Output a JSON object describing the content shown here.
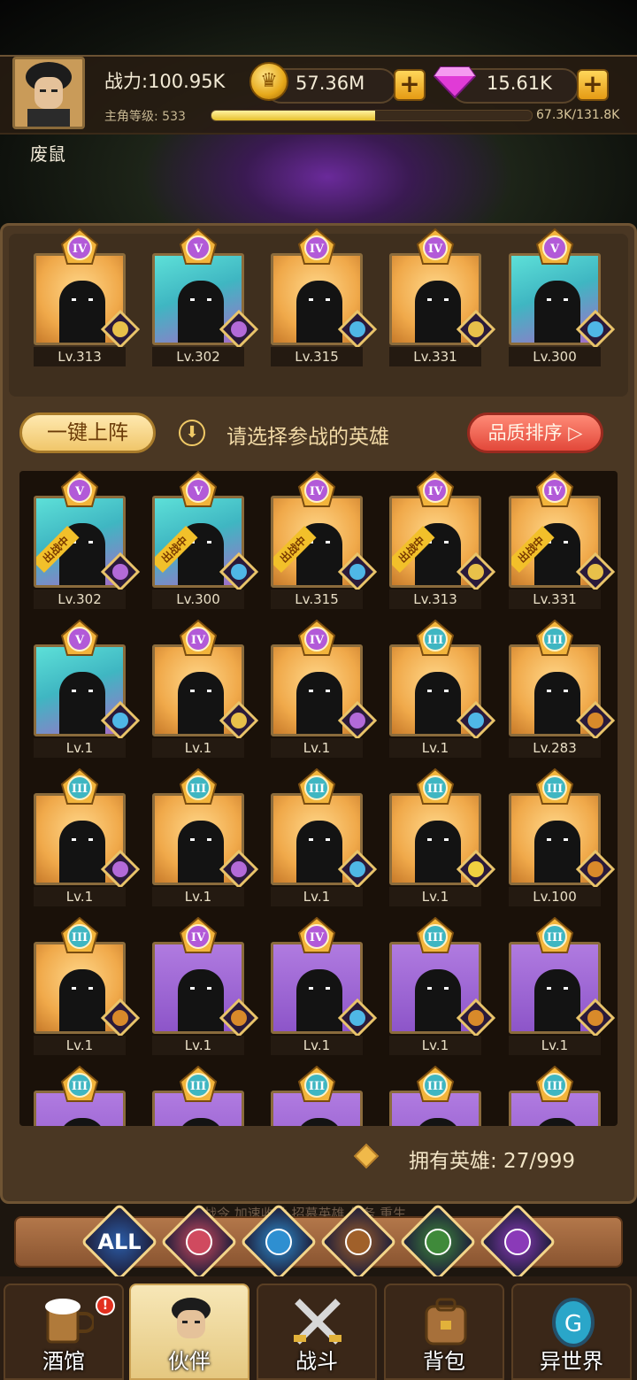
{
  "player": {
    "name": "废鼠",
    "power": "战力:100.95K",
    "level_label": "主角等级: 533",
    "exp_text": "67.3K/131.8K",
    "exp_progress": 0.51
  },
  "resources": {
    "gold": "57.36M",
    "gems": "15.61K"
  },
  "team": [
    {
      "rank": "IV",
      "quality": "gold",
      "faction": "knight",
      "level": "Lv.313"
    },
    {
      "rank": "V",
      "quality": "teal",
      "faction": "demon",
      "level": "Lv.302"
    },
    {
      "rank": "IV",
      "quality": "gold",
      "faction": "spirit",
      "level": "Lv.315"
    },
    {
      "rank": "IV",
      "quality": "gold",
      "faction": "knight",
      "level": "Lv.331"
    },
    {
      "rank": "V",
      "quality": "teal",
      "faction": "spirit",
      "level": "Lv.300"
    }
  ],
  "controls": {
    "auto_deploy": "一键上阵",
    "hint": "请选择参战的英雄",
    "sort": "品质排序 ▷",
    "deployed_ribbon": "出战中"
  },
  "roster": [
    {
      "rank": "V",
      "quality": "teal",
      "faction": "demon",
      "level": "Lv.302",
      "deployed": true
    },
    {
      "rank": "V",
      "quality": "teal",
      "faction": "spirit",
      "level": "Lv.300",
      "deployed": true
    },
    {
      "rank": "IV",
      "quality": "gold",
      "faction": "spirit",
      "level": "Lv.315",
      "deployed": true
    },
    {
      "rank": "IV",
      "quality": "gold",
      "faction": "knight",
      "level": "Lv.313",
      "deployed": true
    },
    {
      "rank": "IV",
      "quality": "gold",
      "faction": "knight",
      "level": "Lv.331",
      "deployed": true
    },
    {
      "rank": "V",
      "quality": "teal",
      "faction": "spirit",
      "level": "Lv.1"
    },
    {
      "rank": "IV",
      "quality": "gold",
      "faction": "knight",
      "level": "Lv.1"
    },
    {
      "rank": "IV",
      "quality": "gold",
      "faction": "demon",
      "level": "Lv.1"
    },
    {
      "rank": "III",
      "quality": "gold",
      "faction": "spirit",
      "level": "Lv.1"
    },
    {
      "rank": "III",
      "quality": "gold",
      "faction": "lion",
      "level": "Lv.283"
    },
    {
      "rank": "III",
      "quality": "gold",
      "faction": "demon",
      "level": "Lv.1"
    },
    {
      "rank": "III",
      "quality": "gold",
      "faction": "demon",
      "level": "Lv.1"
    },
    {
      "rank": "III",
      "quality": "gold",
      "faction": "spirit",
      "level": "Lv.1"
    },
    {
      "rank": "III",
      "quality": "gold",
      "faction": "elf",
      "level": "Lv.1"
    },
    {
      "rank": "III",
      "quality": "gold",
      "faction": "lion",
      "level": "Lv.100"
    },
    {
      "rank": "III",
      "quality": "gold",
      "faction": "lion",
      "level": "Lv.1"
    },
    {
      "rank": "IV",
      "quality": "purple",
      "faction": "lion",
      "level": "Lv.1"
    },
    {
      "rank": "IV",
      "quality": "purple",
      "faction": "spirit",
      "level": "Lv.1"
    },
    {
      "rank": "III",
      "quality": "purple",
      "faction": "lion",
      "level": "Lv.1"
    },
    {
      "rank": "III",
      "quality": "purple",
      "faction": "lion",
      "level": "Lv.1"
    },
    {
      "rank": "III",
      "quality": "purple",
      "faction": "lion",
      "level": ""
    },
    {
      "rank": "III",
      "quality": "purple",
      "faction": "lion",
      "level": ""
    },
    {
      "rank": "III",
      "quality": "purple",
      "faction": "lion",
      "level": ""
    },
    {
      "rank": "III",
      "quality": "purple",
      "faction": "lion",
      "level": ""
    },
    {
      "rank": "III",
      "quality": "purple",
      "faction": "lion",
      "level": ""
    }
  ],
  "hero_count": "拥有英雄: 27/999",
  "ghost_tabs": "战令     加速收益     招募英雄     任务     重生",
  "filters": [
    {
      "id": "all",
      "label": "ALL",
      "color": "#2b5da8"
    },
    {
      "id": "knight",
      "label": "",
      "color": "#d04a5f"
    },
    {
      "id": "spirit",
      "label": "",
      "color": "#2e8fd1"
    },
    {
      "id": "lion",
      "label": "",
      "color": "#a0602a"
    },
    {
      "id": "elf",
      "label": "",
      "color": "#3f8a3a"
    },
    {
      "id": "demon",
      "label": "",
      "color": "#8a3ab8"
    }
  ],
  "nav": [
    {
      "id": "tavern",
      "label": "酒馆"
    },
    {
      "id": "partners",
      "label": "伙伴"
    },
    {
      "id": "battle",
      "label": "战斗"
    },
    {
      "id": "bag",
      "label": "背包"
    },
    {
      "id": "otherworld",
      "label": "异世界"
    }
  ],
  "alert_badge": "!",
  "colors": {
    "badge_gold": "#f2b43b",
    "badge_purple": "#b25ad8",
    "badge_teal": "#3fb6c2",
    "faction_spirit": "#4fb7e6",
    "faction_demon": "#b36ad8",
    "faction_knight": "#e8c04a",
    "faction_lion": "#d98a2a",
    "faction_elf": "#f0d040"
  }
}
